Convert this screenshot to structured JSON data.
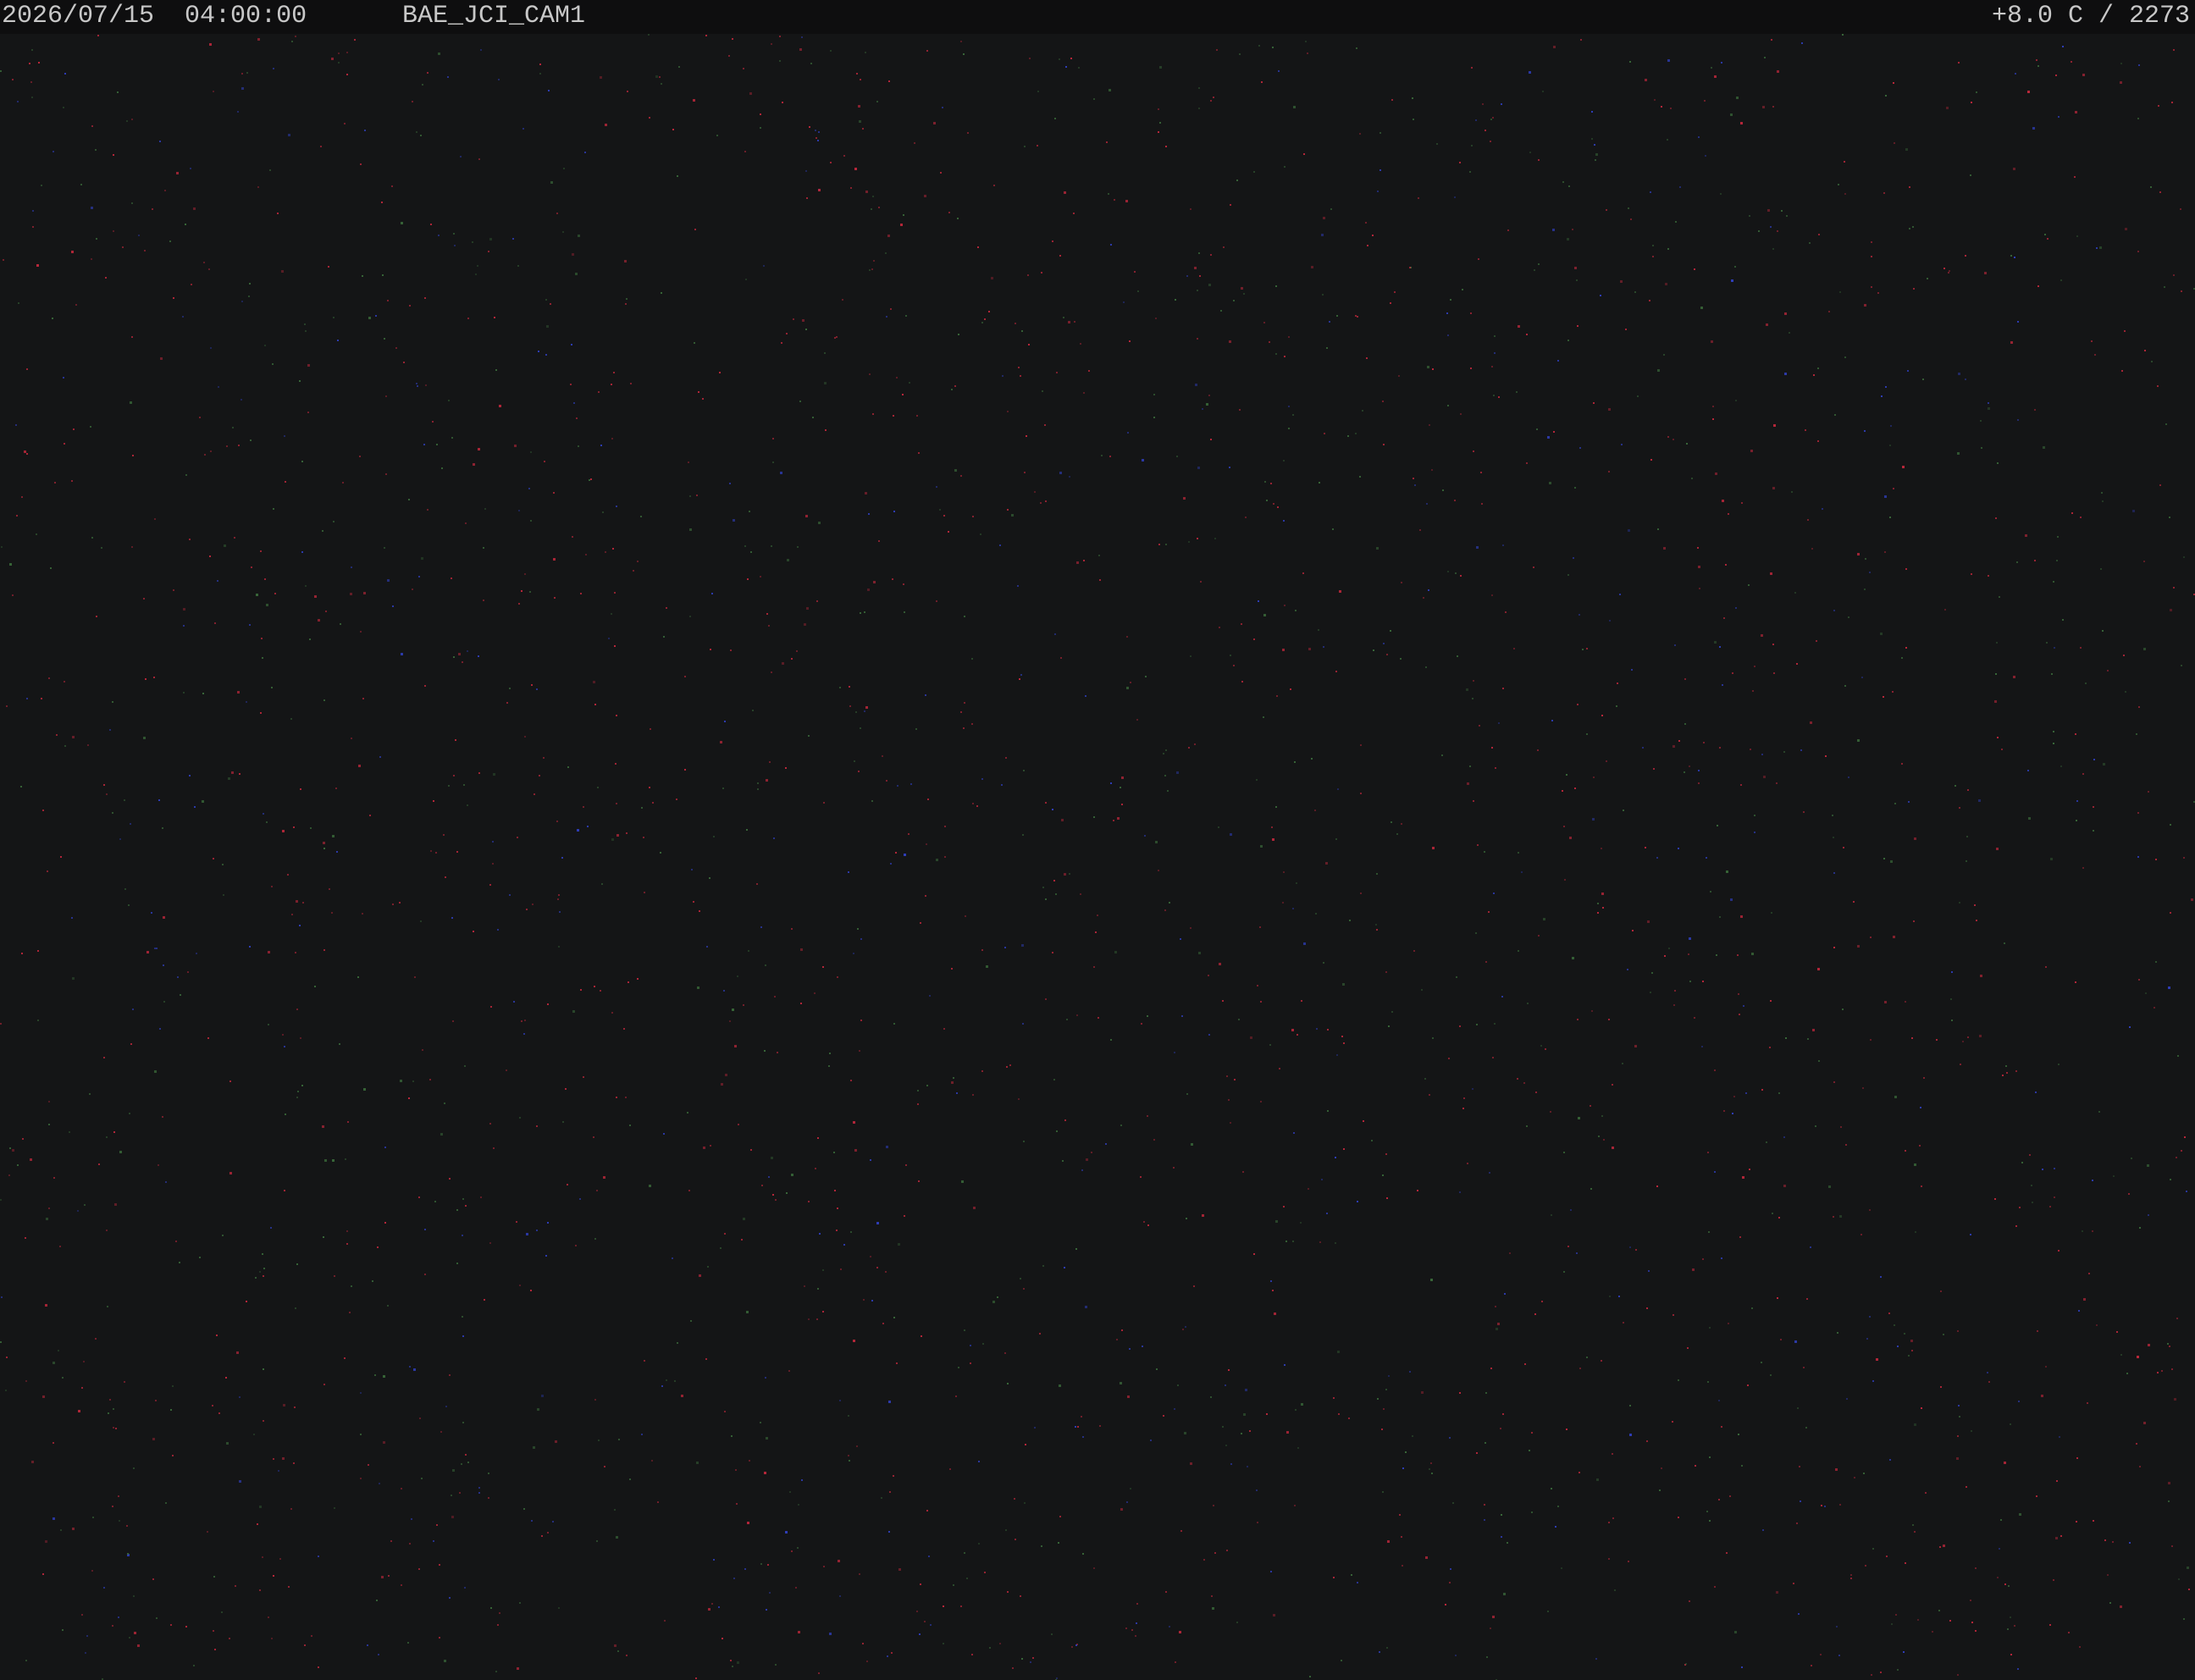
{
  "overlay": {
    "date": "2026/07/15",
    "time": "04:00:00",
    "camera_name": "BAE_JCI_CAM1",
    "sensor_readout": "+8.0 C / 2273"
  },
  "colors": {
    "background": "#141516",
    "overlay_bar": "#0e0e0f",
    "overlay_text": "#c8c8c8",
    "hot_pixel_red": "#c0283c",
    "hot_pixel_green": "#3a6a3a",
    "hot_pixel_blue": "#3040c0"
  }
}
